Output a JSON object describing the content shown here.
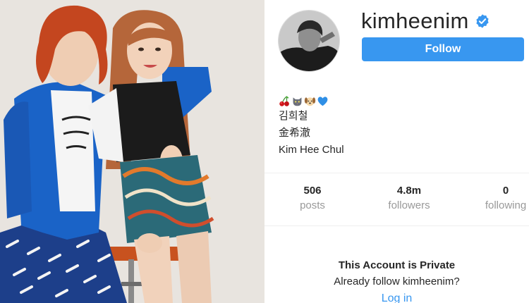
{
  "profile": {
    "username": "kimheenim",
    "verified": true,
    "follow_label": "Follow",
    "bio_emojis": [
      "cherries",
      "cat-face",
      "dog-face",
      "blue-heart"
    ],
    "bio_lines": [
      "김희철",
      "金希澈",
      "Kim Hee Chul"
    ]
  },
  "stats": [
    {
      "value": "506",
      "label": "posts"
    },
    {
      "value": "4.8m",
      "label": "followers"
    },
    {
      "value": "0",
      "label": "following"
    }
  ],
  "private_notice": {
    "title": "This Account is Private",
    "subtitle": "Already follow kimheenim?",
    "login_label": "Log in"
  },
  "colors": {
    "accent": "#3897f0",
    "text": "#262626",
    "muted": "#999999",
    "divider": "#efefef"
  }
}
